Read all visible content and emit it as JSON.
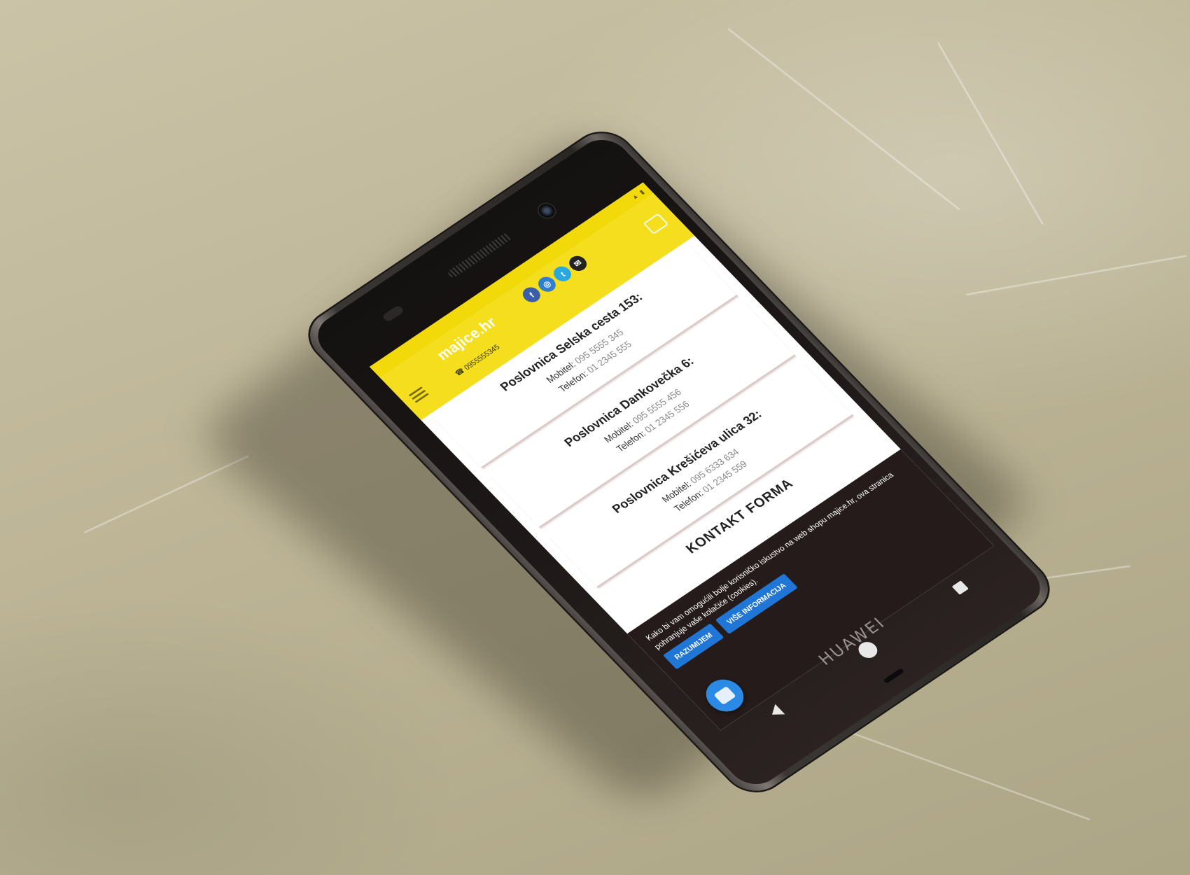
{
  "device": {
    "brand": "HUAWEI"
  },
  "site": {
    "logo": "majice.hr",
    "phone": "0955555345",
    "social_icons": [
      "facebook-icon",
      "instagram-icon",
      "twitter-icon",
      "email-icon"
    ],
    "accent_color": "#f4de1d"
  },
  "locations": [
    {
      "title": "Poslovnica Selska cesta 153:",
      "mobile_label": "Mobitel:",
      "mobile": "095 5555 345",
      "phone_label": "Telefon:",
      "phone": "01 2345 555"
    },
    {
      "title": "Poslovnica Dankovečka 6:",
      "mobile_label": "Mobitel:",
      "mobile": "095 5555 456",
      "phone_label": "Telefon:",
      "phone": "01 2345 556"
    },
    {
      "title": "Poslovnica Krešićeva ulica 32:",
      "mobile_label": "Mobitel:",
      "mobile": "095 6333 634",
      "phone_label": "Telefon:",
      "phone": "01 2345 559"
    }
  ],
  "contact": {
    "title": "KONTAKT FORMA"
  },
  "cookie_bar": {
    "text": "Kako bi vam omogućili bolje korisničko iskustvo na web shopu majice.hr, ova stranica pohranjuje vaše kolačiće (cookies).",
    "accept_label": "RAZUMIJEM",
    "more_label": "VIŠE INFORMACIJA"
  }
}
